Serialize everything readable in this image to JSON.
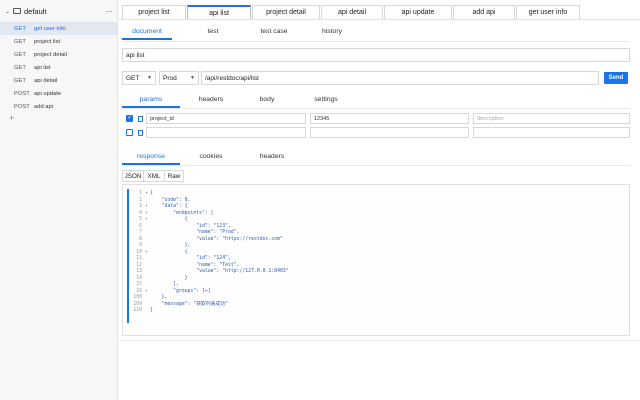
{
  "sidebar": {
    "folder_name": "default",
    "more": "···",
    "add": "+",
    "items": [
      {
        "method": "GET",
        "name": "get user info",
        "active": true
      },
      {
        "method": "GET",
        "name": "project list"
      },
      {
        "method": "GET",
        "name": "project detail"
      },
      {
        "method": "GET",
        "name": "api list"
      },
      {
        "method": "GET",
        "name": "api detail"
      },
      {
        "method": "POST",
        "name": "api update"
      },
      {
        "method": "POST",
        "name": "add api"
      }
    ]
  },
  "tabs": [
    "project list",
    "api list",
    "project detail",
    "api detail",
    "api update",
    "add api",
    "get user info"
  ],
  "active_tab": "api list",
  "subtabs": [
    "document",
    "test",
    "test case",
    "history"
  ],
  "api_name": "api list",
  "request": {
    "method": "GET",
    "env": "Prod",
    "url": "/api/restdoc/api/list",
    "send_label": "Send"
  },
  "param_tabs": [
    "params",
    "headers",
    "body",
    "settings"
  ],
  "params": [
    {
      "checked": true,
      "key": "project_id",
      "value": "12345",
      "description": "",
      "description_placeholder": "description"
    },
    {
      "checked": false,
      "key": "",
      "value": "",
      "description": ""
    }
  ],
  "response_tabs": [
    "response",
    "cookies",
    "headers"
  ],
  "formats": [
    "JSON",
    "XML",
    "Raw"
  ],
  "code_lines": [
    {
      "n": "1",
      "fold": true,
      "text": "{"
    },
    {
      "n": "2",
      "text": "    \"code\": 0,"
    },
    {
      "n": "3",
      "fold": true,
      "text": "    \"data\": {"
    },
    {
      "n": "4",
      "fold": true,
      "text": "        \"endpoints\": ["
    },
    {
      "n": "5",
      "fold": true,
      "text": "            {"
    },
    {
      "n": "6",
      "text": "                \"id\": \"123\","
    },
    {
      "n": "7",
      "text": "                \"name\": \"Prod\","
    },
    {
      "n": "8",
      "text": "                \"value\": \"https://restdoc.com\""
    },
    {
      "n": "9",
      "text": "            },"
    },
    {
      "n": "10",
      "fold": true,
      "text": "            {"
    },
    {
      "n": "11",
      "text": "                \"id\": \"124\","
    },
    {
      "n": "12",
      "text": "                \"name\": \"Test\","
    },
    {
      "n": "13",
      "text": "                \"value\": \"http://127.0.0.1:8403\""
    },
    {
      "n": "14",
      "text": "            }"
    },
    {
      "n": "15",
      "text": "        ],"
    },
    {
      "n": "16",
      "fold": true,
      "text": "        \"groups\": [↔]"
    },
    {
      "n": "108",
      "text": "    },"
    },
    {
      "n": "109",
      "text": "    \"message\": \"获取列表成功\""
    },
    {
      "n": "110",
      "text": "}"
    }
  ]
}
